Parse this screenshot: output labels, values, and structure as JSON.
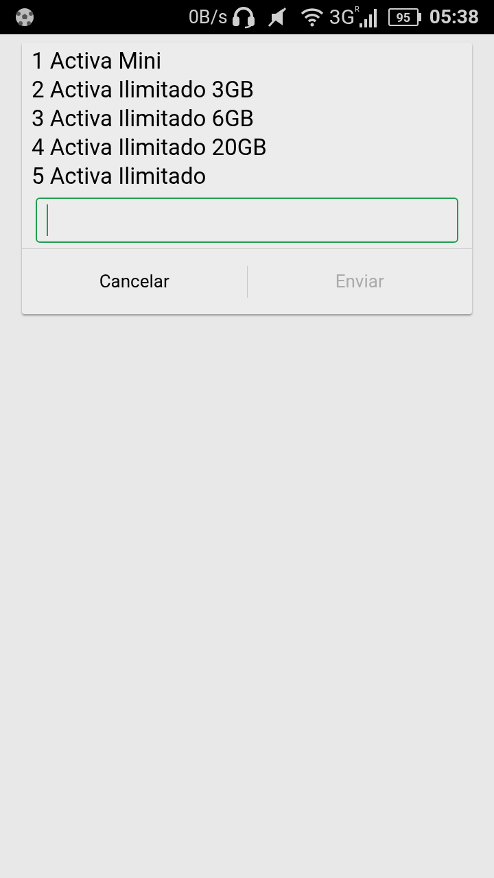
{
  "status_bar": {
    "speed": "0B/s",
    "network": "3G",
    "roaming": "R",
    "battery": "95",
    "time": "05:38"
  },
  "dialog": {
    "message_lines": [
      "1 Activa Mini",
      "2 Activa Ilimitado 3GB",
      "3 Activa Ilimitado 6GB",
      "4 Activa Ilimitado 20GB",
      "5 Activa Ilimitado"
    ],
    "input": {
      "focused": true
    },
    "buttons": [
      {
        "label": "Cancelar",
        "disabled": false
      },
      {
        "label": "Enviar",
        "disabled": true
      }
    ]
  }
}
